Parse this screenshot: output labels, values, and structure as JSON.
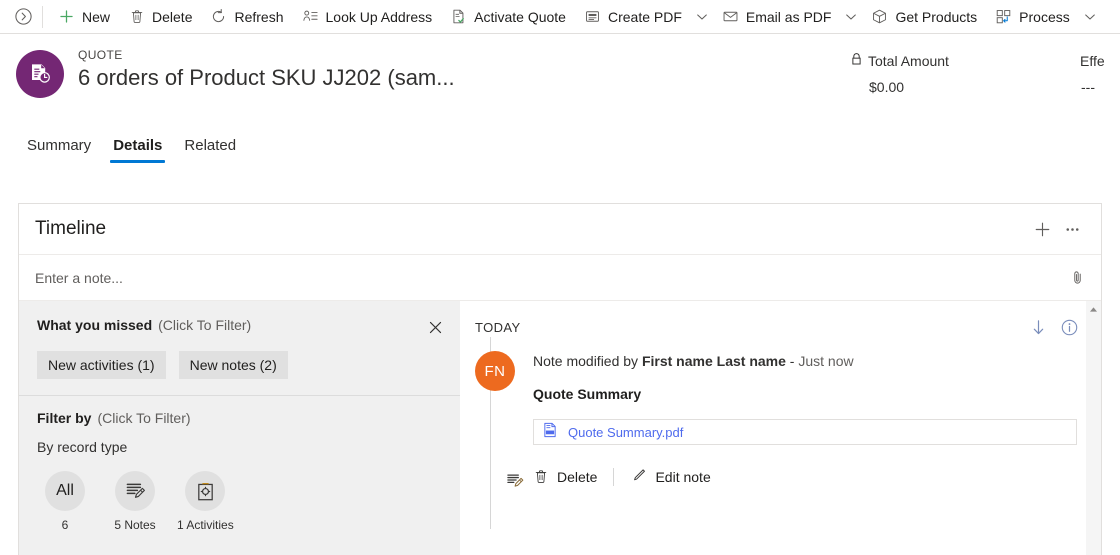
{
  "commandbar": {
    "collapse_label": "",
    "items": [
      {
        "label": "New",
        "icon": "plus-icon",
        "chevron": false
      },
      {
        "label": "Delete",
        "icon": "trash-icon",
        "chevron": false
      },
      {
        "label": "Refresh",
        "icon": "refresh-icon",
        "chevron": false
      },
      {
        "label": "Look Up Address",
        "icon": "address-lookup-icon",
        "chevron": false
      },
      {
        "label": "Activate Quote",
        "icon": "activate-quote-icon",
        "chevron": false
      },
      {
        "label": "Create PDF",
        "icon": "create-pdf-icon",
        "chevron": true
      },
      {
        "label": "Email as PDF",
        "icon": "email-icon",
        "chevron": true
      },
      {
        "label": "Get Products",
        "icon": "products-box-icon",
        "chevron": false
      },
      {
        "label": "Process",
        "icon": "process-icon",
        "chevron": true
      }
    ]
  },
  "record_header": {
    "entity_type": "QUOTE",
    "title": "6 orders of Product SKU JJ202 (sam...",
    "avatar_icon": "quote-document-icon",
    "fields": [
      {
        "label": "Total Amount",
        "value": "$0.00",
        "locked": true
      },
      {
        "label": "Effe",
        "value": "---",
        "locked": false
      }
    ]
  },
  "tabs": [
    {
      "label": "Summary",
      "active": false
    },
    {
      "label": "Details",
      "active": true
    },
    {
      "label": "Related",
      "active": false
    }
  ],
  "timeline": {
    "title": "Timeline",
    "add_icon": "plus-icon",
    "more_icon": "ellipsis-icon",
    "note_input": {
      "placeholder": "Enter a note...",
      "value": "",
      "attach_icon": "paperclip-icon"
    },
    "filter_pane": {
      "what_you_missed": {
        "title": "What you missed",
        "subtitle": "(Click To Filter)",
        "close_icon": "close-icon",
        "chips": [
          {
            "label": "New activities (1)"
          },
          {
            "label": "New notes (2)"
          }
        ]
      },
      "filter_by": {
        "title": "Filter by",
        "subtitle": "(Click To Filter)",
        "group_label": "By record type",
        "options": [
          {
            "glyph": "All",
            "icon": "",
            "caption": "6"
          },
          {
            "glyph": "",
            "icon": "note-edit-icon",
            "caption": "5 Notes"
          },
          {
            "glyph": "",
            "icon": "activity-clipboard-icon",
            "caption": "1 Activities"
          }
        ]
      }
    },
    "feed": {
      "group_label": "TODAY",
      "sort_icon": "sort-down-arrow-icon",
      "info_icon": "info-circle-icon",
      "entries": [
        {
          "avatar_initials": "FN",
          "avatar_color": "#ed6a1f",
          "badge_icon": "note-edit-icon",
          "meta_prefix": "Note modified by ",
          "meta_author": "First name Last name",
          "meta_separator": " - ",
          "meta_time": "Just now",
          "subject": "Quote Summary",
          "attachment": {
            "icon": "pdf-file-icon",
            "name": "Quote Summary.pdf",
            "color": "#4f6bed"
          },
          "actions": [
            {
              "label": "Delete",
              "icon": "trash-icon"
            },
            {
              "label": "Edit note",
              "icon": "pencil-icon"
            }
          ]
        }
      ]
    }
  },
  "colors": {
    "accent": "#0078d4",
    "quote_avatar": "#742774",
    "user_avatar": "#ed6a1f",
    "link": "#4f6bed",
    "filter_pane_bg": "#f0f0f0"
  }
}
